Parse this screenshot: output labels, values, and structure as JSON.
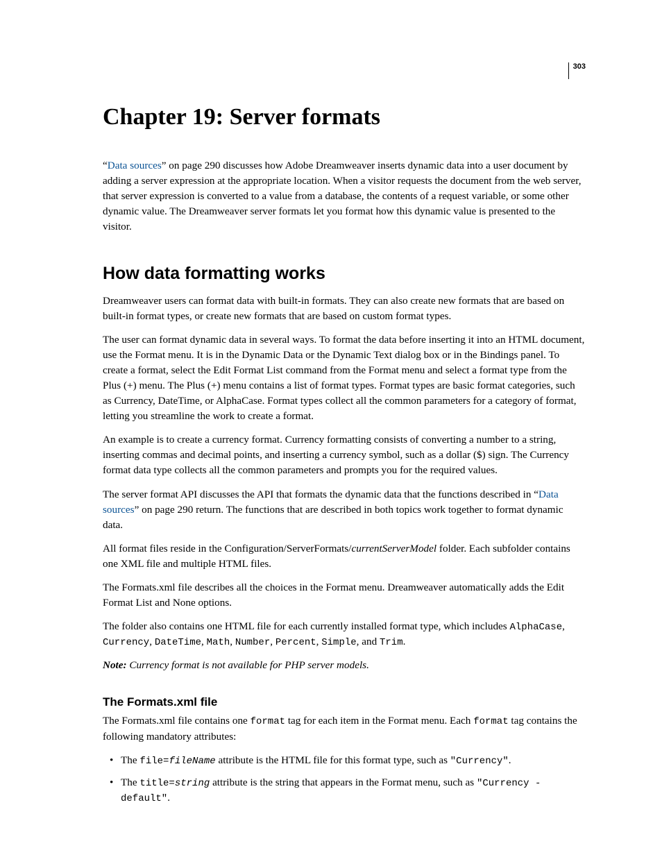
{
  "pageNumber": "303",
  "chapterTitle": "Chapter 19: Server formats",
  "intro": {
    "quoteOpen": "“",
    "link": "Data sources",
    "afterLink": "” on page 290 discusses how Adobe Dreamweaver inserts dynamic data into a user document by adding a server expression at the appropriate location. When a visitor requests the document from the web server, that server expression is converted to a value from a database, the contents of a request variable, or some other dynamic value. The Dreamweaver server formats let you format how this dynamic value is presented to the visitor."
  },
  "section1": {
    "heading": "How data formatting works",
    "p1": "Dreamweaver users can format data with built-in formats. They can also create new formats that are based on built-in format types, or create new formats that are based on custom format types.",
    "p2": "The user can format dynamic data in several ways. To format the data before inserting it into an HTML document, use the Format menu. It is in the Dynamic Data or the Dynamic Text dialog box or in the Bindings panel. To create a format, select the Edit Format List command from the Format menu and select a format type from the Plus (+) menu. The Plus (+) menu contains a list of format types. Format types are basic format categories, such as Currency, DateTime, or AlphaCase. Format types collect all the common parameters for a category of format, letting you streamline the work to create a format.",
    "p3": "An example is to create a currency format. Currency formatting consists of converting a number to a string, inserting commas and decimal points, and inserting a currency symbol, such as a dollar ($) sign. The Currency format data type collects all the common parameters and prompts you for the required values.",
    "p4": {
      "before": "The server format API discusses the API that formats the dynamic data that the functions described in “",
      "link": "Data sources",
      "after": "” on page 290 return. The functions that are described in both topics work together to format dynamic data."
    },
    "p5": {
      "t1": "All format files reside in the Configuration/ServerFormats/",
      "i1": "currentServerModel",
      "t2": " folder. Each subfolder contains one XML file and multiple HTML files."
    },
    "p6": "The Formats.xml file describes all the choices in the Format menu. Dreamweaver automatically adds the Edit Format List and None options.",
    "p7": {
      "t1": "The folder also contains one HTML file for each currently installed format type, which includes ",
      "c1": "AlphaCase",
      "t2": ", ",
      "c2": "Currency",
      "t3": ", ",
      "c3": "DateTime",
      "t4": ", ",
      "c4": "Math",
      "t5": ", ",
      "c5": "Number",
      "t6": ", ",
      "c6": "Percent",
      "t7": ", ",
      "c7": "Simple",
      "t8": ", and ",
      "c8": "Trim",
      "t9": "."
    },
    "note": {
      "label": "Note:",
      "text": " Currency format is not available for PHP server models."
    }
  },
  "section2": {
    "heading": "The Formats.xml file",
    "p1": {
      "t1": "The Formats.xml file contains one ",
      "c1": "format",
      "t2": " tag for each item in the Format menu. Each ",
      "c2": "format",
      "t3": " tag contains the following mandatory attributes:"
    },
    "bullets": {
      "b1": {
        "t1": "The ",
        "c1": "file=",
        "ci1": "fileName",
        "t2": " attribute is the HTML file for this format type, such as ",
        "c2": "\"Currency\"",
        "t3": "."
      },
      "b2": {
        "t1": "The ",
        "c1": "title=",
        "ci1": "string",
        "t2": " attribute is the string that appears in the Format menu, such as ",
        "c2": "\"Currency - default\"",
        "t3": "."
      }
    }
  }
}
